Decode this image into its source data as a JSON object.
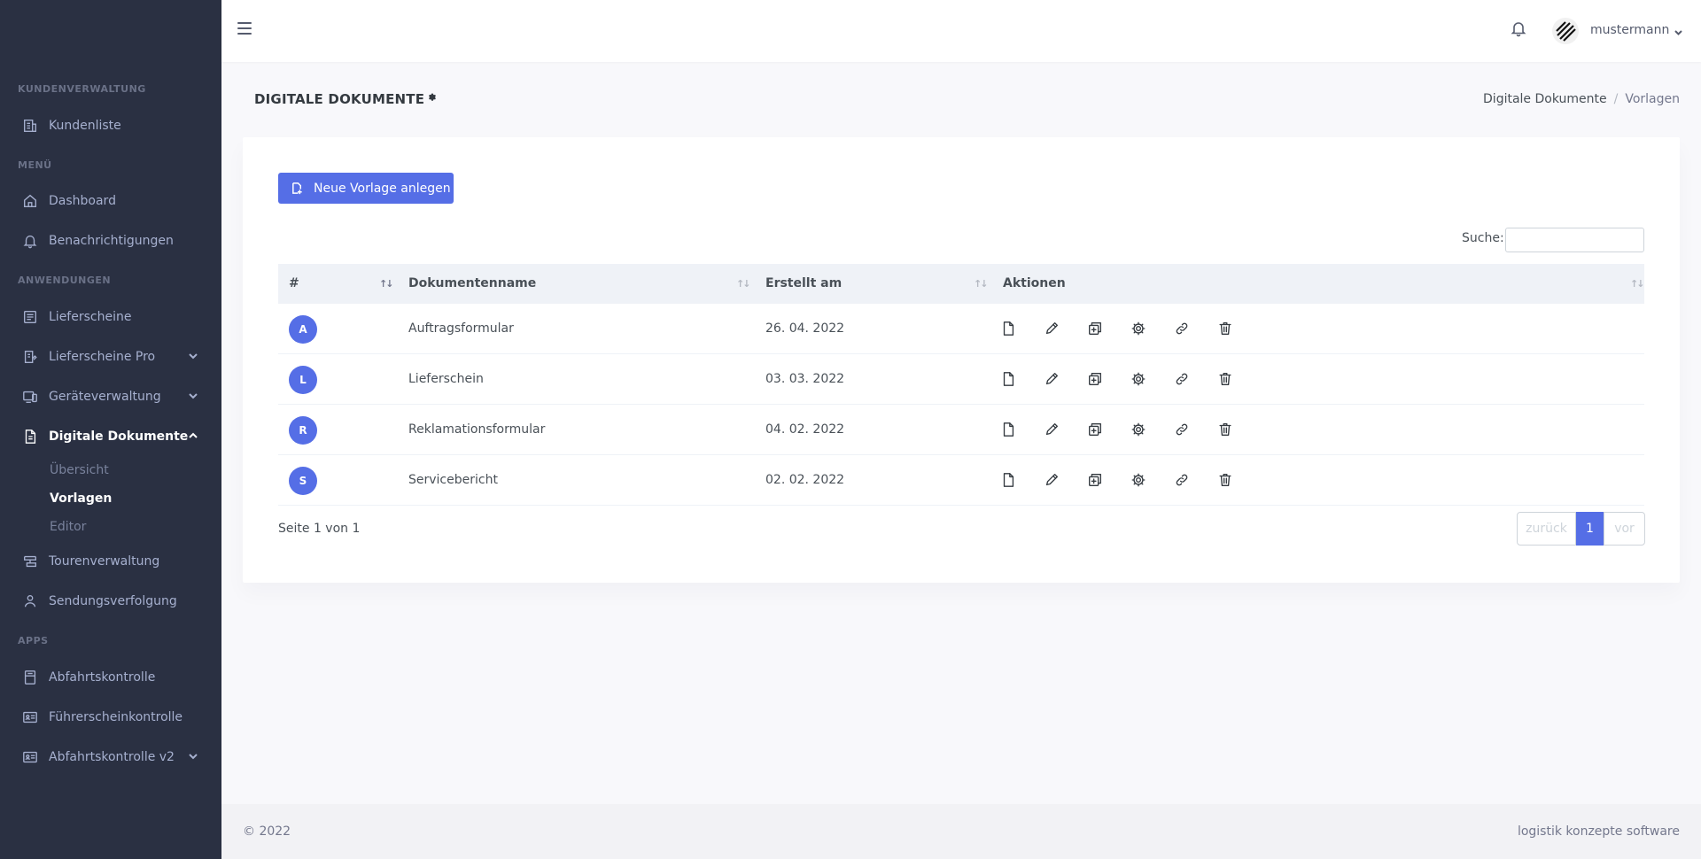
{
  "sidebar": {
    "sections": [
      {
        "title": "KUNDENVERWALTUNG"
      },
      {
        "title": "MENÜ"
      },
      {
        "title": "ANWENDUNGEN"
      },
      {
        "title": "APPS"
      }
    ],
    "items": [
      {
        "label": "Kundenliste",
        "icon": "building-icon"
      },
      {
        "label": "Dashboard",
        "icon": "home-icon"
      },
      {
        "label": "Benachrichtigungen",
        "icon": "bell-icon"
      },
      {
        "label": "Lieferscheine",
        "icon": "receipt-icon"
      },
      {
        "label": "Lieferscheine Pro",
        "icon": "receipt-edit-icon"
      },
      {
        "label": "Geräteverwaltung",
        "icon": "devices-icon"
      },
      {
        "label": "Digitale Dokumente",
        "icon": "document-icon"
      },
      {
        "label": "Tourenverwaltung",
        "icon": "route-icon"
      },
      {
        "label": "Sendungsverfolgung",
        "icon": "tracking-icon"
      },
      {
        "label": "Abfahrtskontrolle",
        "icon": "checklist-icon"
      },
      {
        "label": "Führerscheinkontrolle",
        "icon": "id-card-icon"
      },
      {
        "label": "Abfahrtskontrolle v2",
        "icon": "id-card-icon"
      }
    ],
    "subitems": [
      {
        "label": "Übersicht"
      },
      {
        "label": "Vorlagen"
      },
      {
        "label": "Editor"
      }
    ]
  },
  "topbar": {
    "username": "mustermann"
  },
  "page": {
    "title": "DIGITALE DOKUMENTE",
    "breadcrumb": [
      "Digitale Dokumente",
      "/",
      "Vorlagen"
    ]
  },
  "card": {
    "new_button": "Neue Vorlage anlegen",
    "search_label": "Suche:",
    "search_value": ""
  },
  "table": {
    "headers": [
      "#",
      "Dokumentenname",
      "Erstellt am",
      "Aktionen"
    ],
    "rows": [
      {
        "initial": "A",
        "name": "Auftragsformular",
        "date": "26. 04. 2022"
      },
      {
        "initial": "L",
        "name": "Lieferschein",
        "date": "03. 03. 2022"
      },
      {
        "initial": "R",
        "name": "Reklamationsformular",
        "date": "04. 02. 2022"
      },
      {
        "initial": "S",
        "name": "Servicebericht",
        "date": "02. 02. 2022"
      }
    ],
    "row_actions": [
      "file-icon",
      "pencil-icon",
      "duplicate-icon",
      "gear-icon",
      "link-icon",
      "trash-icon"
    ]
  },
  "pagination": {
    "info": "Seite 1 von 1",
    "prev": "zurück",
    "current": "1",
    "next": "vor"
  },
  "footer": {
    "copyright": "© 2022",
    "brand": "logistik konzepte software"
  },
  "colors": {
    "sidebar": "#2a3042",
    "accent": "#556ee6",
    "background": "#f8f8fb"
  }
}
